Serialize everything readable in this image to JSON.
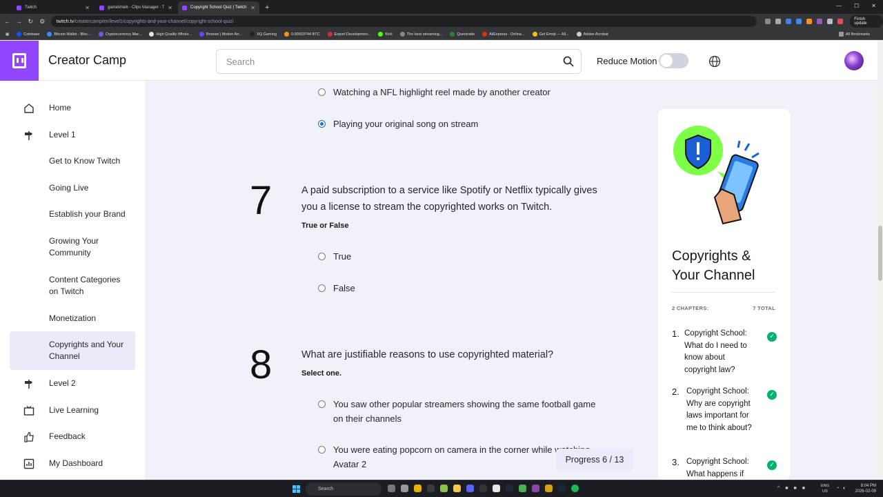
{
  "browser": {
    "tabs": [
      {
        "title": "Twitch",
        "active": false
      },
      {
        "title": "gametimeb - Clips Manager - T",
        "active": false
      },
      {
        "title": "Copyright School Quiz | Twitch",
        "active": true
      }
    ],
    "new_tab": "+",
    "url_domain": "twitch.tv",
    "url_path": "/creatorcamp/en/level1/copyrights-and-your-channel/copyright-school-quiz/",
    "finish_update": "Finish update",
    "bookmarks": [
      {
        "label": "Coinbase",
        "color": "#1652f0"
      },
      {
        "label": "Bitcoin Wallet - Bloc...",
        "color": "#3d89f5"
      },
      {
        "label": "Cryptocurrency Mar...",
        "color": "#6c5ce7"
      },
      {
        "label": "High Quality Whole...",
        "color": "#e5e5e5"
      },
      {
        "label": "Browse | Motion Arr...",
        "color": "#5b4bff"
      },
      {
        "label": "XQ Gaming",
        "color": "#222222"
      },
      {
        "label": "0.00003744 BTC",
        "color": "#f7931a"
      },
      {
        "label": "Export Developmen...",
        "color": "#d32f2f"
      },
      {
        "label": "Kick",
        "color": "#53fc18"
      },
      {
        "label": "The best streaming...",
        "color": "#888888"
      },
      {
        "label": "Questrade",
        "color": "#2e7d32"
      },
      {
        "label": "AliExpress - Online...",
        "color": "#e62e04"
      },
      {
        "label": "Get Emoji — All...",
        "color": "#f4c20d"
      },
      {
        "label": "Adobe Acrobat",
        "color": "#cccccc"
      }
    ],
    "all_bookmarks": "All Bookmarks"
  },
  "header": {
    "brand": "Creator Camp",
    "search_placeholder": "Search",
    "reduce_motion_label": "Reduce Motion",
    "reduce_motion_on": false
  },
  "sidebar": {
    "items": [
      {
        "label": "Home",
        "icon": "home-icon",
        "indent": false,
        "active": false
      },
      {
        "label": "Level 1",
        "icon": "signpost-icon",
        "indent": false,
        "active": false
      },
      {
        "label": "Get to Know Twitch",
        "icon": "",
        "indent": true,
        "active": false
      },
      {
        "label": "Going Live",
        "icon": "",
        "indent": true,
        "active": false
      },
      {
        "label": "Establish your Brand",
        "icon": "",
        "indent": true,
        "active": false
      },
      {
        "label": "Growing Your Community",
        "icon": "",
        "indent": true,
        "active": false
      },
      {
        "label": "Content Categories on Twitch",
        "icon": "",
        "indent": true,
        "active": false
      },
      {
        "label": "Monetization",
        "icon": "",
        "indent": true,
        "active": false
      },
      {
        "label": "Copyrights and Your Channel",
        "icon": "",
        "indent": true,
        "active": true
      },
      {
        "label": "Level 2",
        "icon": "signpost-icon",
        "indent": false,
        "active": false
      },
      {
        "label": "Live Learning",
        "icon": "tv-icon",
        "indent": false,
        "active": false
      },
      {
        "label": "Feedback",
        "icon": "thumbs-up-icon",
        "indent": false,
        "active": false
      },
      {
        "label": "My Dashboard",
        "icon": "dashboard-icon",
        "indent": false,
        "active": false
      }
    ]
  },
  "quiz": {
    "prev_options": [
      {
        "label": "Watching a NFL highlight reel made by another creator",
        "selected": false
      },
      {
        "label": "Playing your original song on stream",
        "selected": true
      }
    ],
    "q7": {
      "number": "7",
      "text": "A paid subscription to a service like Spotify or Netflix typically gives you a license to stream the copyrighted works on Twitch.",
      "type": "True or False",
      "options": [
        {
          "label": "True",
          "selected": false
        },
        {
          "label": "False",
          "selected": false
        }
      ]
    },
    "q8": {
      "number": "8",
      "text": "What are justifiable reasons to use copyrighted material?",
      "type": "Select one.",
      "options": [
        {
          "label": "You saw other popular streamers showing the same football game on their channels",
          "selected": false
        },
        {
          "label": "You were eating popcorn on camera in the corner while watching Avatar 2",
          "selected": false
        }
      ]
    },
    "progress_label": "Progress",
    "progress_current": "6",
    "progress_total": "13",
    "progress_fraction": 0.4615
  },
  "course_card": {
    "title": "Copyrights & Your Channel",
    "chapters_label": "2 CHAPTERS:",
    "total_label": "7 TOTAL",
    "chapters": [
      {
        "num": "1.",
        "title": "Copyright School: What do I need to know about copyright law?",
        "done": true
      },
      {
        "num": "2.",
        "title": "Copyright School: Why are copyright laws important for me to think about?",
        "done": true
      },
      {
        "num": "3.",
        "title": "Copyright School: What happens if",
        "done": true
      }
    ]
  },
  "taskbar": {
    "search": "Search",
    "lang_top": "ENG",
    "lang_bottom": "US",
    "time": "8:04 PM",
    "date": "2026-02-09"
  },
  "colors": {
    "brand_purple": "#9147ff",
    "radio_blue": "#1f6fd6",
    "check_green": "#00b36b",
    "page_bg": "#f0f1f9"
  }
}
